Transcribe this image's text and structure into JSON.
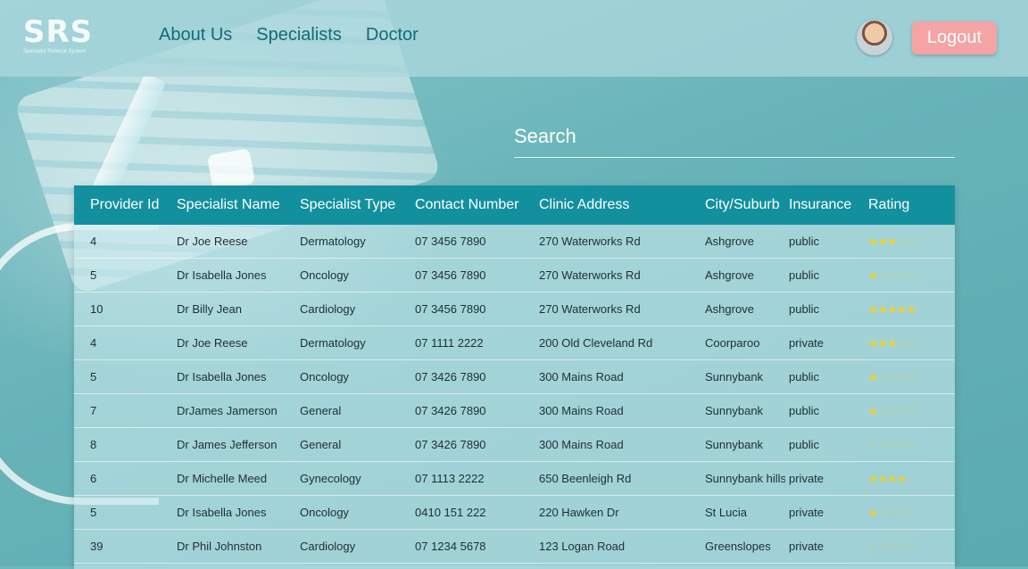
{
  "logo": {
    "text": "SRS",
    "subtitle": "Specialist Referral System"
  },
  "nav": {
    "items": [
      {
        "label": "About Us",
        "name": "nav-about-us"
      },
      {
        "label": "Specialists",
        "name": "nav-specialists"
      },
      {
        "label": "Doctor",
        "name": "nav-doctor"
      }
    ]
  },
  "header": {
    "logout_label": "Logout"
  },
  "search": {
    "placeholder": "Search"
  },
  "table": {
    "columns": [
      "Provider Id",
      "Specialist Name",
      "Specialist Type",
      "Contact Number",
      "Clinic Address",
      "City/Suburb",
      "Insurance",
      "Rating"
    ],
    "rows": [
      [
        "4",
        "Dr Joe Reese",
        "Dermatology",
        "07 3456 7890",
        "270 Waterworks Rd",
        "Ashgrove",
        "public",
        3
      ],
      [
        "5",
        "Dr Isabella Jones",
        "Oncology",
        "07 3456 7890",
        "270 Waterworks Rd",
        "Ashgrove",
        "public",
        1
      ],
      [
        "10",
        "Dr Billy Jean",
        "Cardiology",
        "07 3456 7890",
        "270 Waterworks Rd",
        "Ashgrove",
        "public",
        5
      ],
      [
        "4",
        "Dr Joe Reese",
        "Dermatology",
        "07 1111 2222",
        "200 Old Cleveland Rd",
        "Coorparoo",
        "private",
        3
      ],
      [
        "5",
        "Dr Isabella Jones",
        "Oncology",
        "07 3426 7890",
        "300 Mains Road",
        "Sunnybank",
        "public",
        1
      ],
      [
        "7",
        "DrJames Jamerson",
        "General",
        "07 3426 7890",
        "300 Mains Road",
        "Sunnybank",
        "public",
        1
      ],
      [
        "8",
        "Dr James Jefferson",
        "General",
        "07 3426 7890",
        "300 Mains Road",
        "Sunnybank",
        "public",
        0
      ],
      [
        "6",
        "Dr Michelle Meed",
        "Gynecology",
        "07 1113 2222",
        "650 Beenleigh Rd",
        "Sunnybank hills",
        "private",
        4
      ],
      [
        "5",
        "Dr Isabella Jones",
        "Oncology",
        "0410 151 222",
        "220 Hawken Dr",
        "St Lucia",
        "private",
        1
      ],
      [
        "39",
        "Dr Phil Johnston",
        "Cardiology",
        "07 1234 5678",
        "123 Logan Road",
        "Greenslopes",
        "private",
        0
      ]
    ],
    "rating_max": 5
  },
  "colors": {
    "header_bg": "#aad7dc",
    "table_header": "#13909d",
    "logout": "#f4a4a4",
    "nav_text": "#136b78",
    "star": "#f7d11a"
  }
}
